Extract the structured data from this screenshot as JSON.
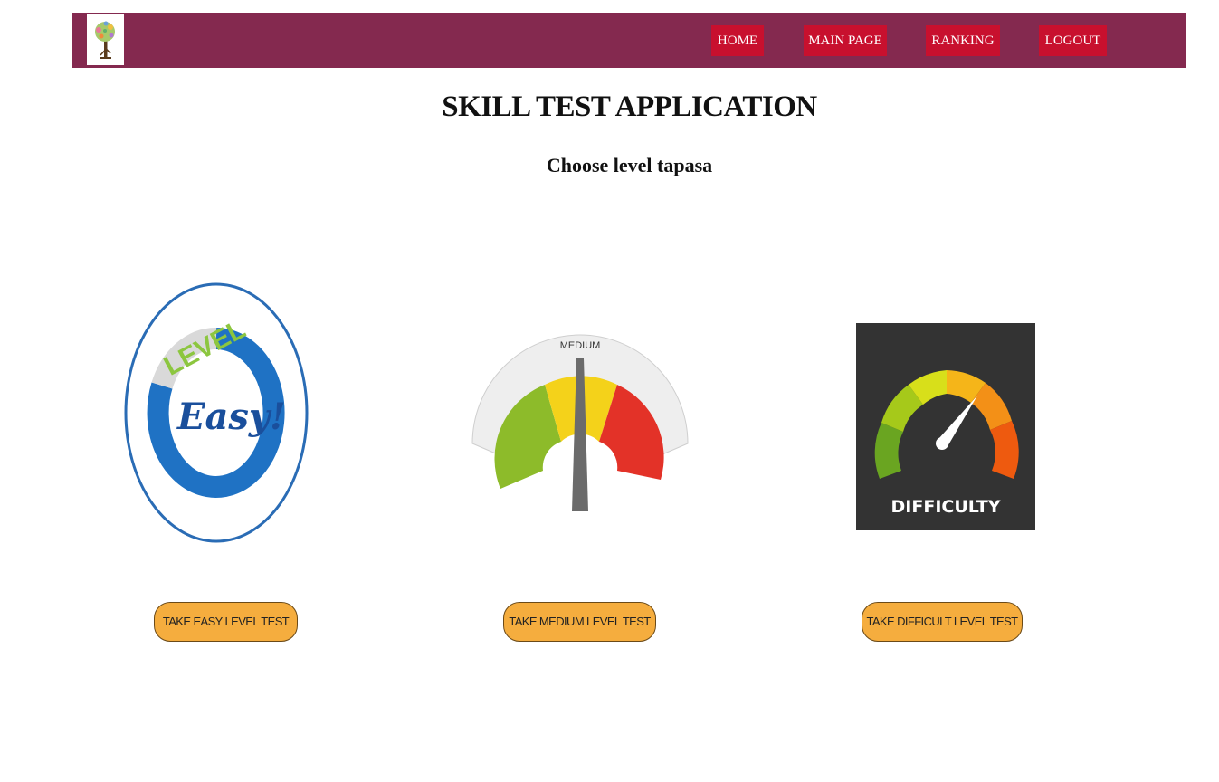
{
  "nav": {
    "items": [
      {
        "label": "HOME"
      },
      {
        "label": "MAIN PAGE"
      },
      {
        "label": "RANKING"
      },
      {
        "label": "LOGOUT"
      }
    ]
  },
  "header": {
    "title": "SKILL TEST APPLICATION",
    "subtitle": "Choose level tapasa"
  },
  "levels": [
    {
      "image_text_top": "LEVEL",
      "image_text_main": "Easy!",
      "button_label": "TAKE EASY LEVEL TEST"
    },
    {
      "image_text": "MEDIUM",
      "button_label": "TAKE MEDIUM LEVEL TEST"
    },
    {
      "image_text": "DIFFICULTY",
      "button_label": "TAKE DIFFICULT LEVEL TEST"
    }
  ],
  "colors": {
    "navbar": "#84294f",
    "nav_button": "#c8102e",
    "take_button": "#f5ad3e"
  },
  "icons": {
    "logo": "tree-logo-icon"
  }
}
